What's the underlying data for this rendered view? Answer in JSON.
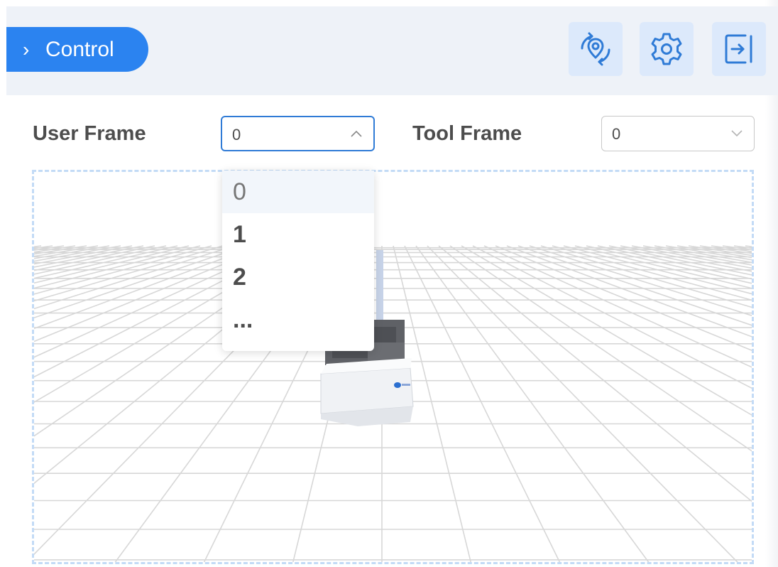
{
  "header": {
    "control_label": "Control",
    "icons": [
      "view-reset-icon",
      "gear-icon",
      "exit-icon"
    ]
  },
  "frames": {
    "user_frame_label": "User Frame",
    "user_frame_value": "0",
    "tool_frame_label": "Tool Frame",
    "tool_frame_value": "0"
  },
  "dropdown": {
    "options": [
      "0",
      "1",
      "2",
      "..."
    ],
    "selected_index": 0
  },
  "colors": {
    "accent": "#2b83f0",
    "icon_blue": "#2f7bd6",
    "header_bg": "#eef2f8"
  }
}
